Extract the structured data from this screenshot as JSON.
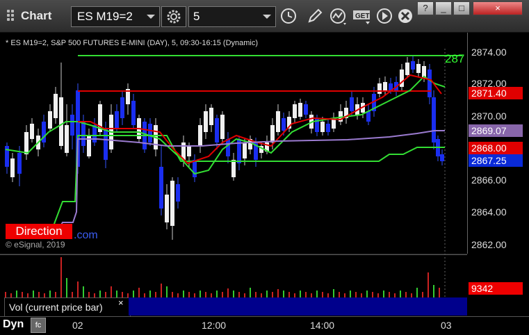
{
  "window": {
    "title": "Chart",
    "symbol": "ES M19=2",
    "interval": "5",
    "buttons": {
      "help": "?",
      "minimize": "_",
      "maximize": "□",
      "close": "×"
    }
  },
  "chart": {
    "header": "* ES M19=2, S&P 500 FUTURES E-MINI (DAY), 5, 09:30-16:15 (Dynamic)",
    "price_labels": [
      "2874.00",
      "2872.00",
      "2870.00",
      "2866.00",
      "2864.00",
      "2862.00"
    ],
    "price_tags": [
      {
        "text": "2871.40",
        "color": "#e00000"
      },
      {
        "text": "2869.07",
        "color": "#8866aa"
      },
      {
        "text": "2868.00",
        "color": "#e00000"
      },
      {
        "text": "2867.25",
        "color": "#0a2ad8"
      }
    ],
    "cutoff_label": "287",
    "direction_label": "Direction",
    "watermark_suffix": ".com",
    "copyright": "© eSignal, 2019"
  },
  "chart_data": {
    "type": "candlestick",
    "ylim": [
      2861.5,
      2875
    ],
    "y_ticks": [
      2874,
      2872,
      2870,
      2866,
      2864,
      2862
    ],
    "x_ticks": [
      "02",
      "12:00",
      "14:00",
      "03"
    ],
    "lines": [
      {
        "name": "",
        "color": "#33dd33",
        "value": 2873.6
      },
      {
        "name": "",
        "color": "#e00000",
        "value": 2871.4
      }
    ]
  },
  "volume": {
    "label": "Vol (current price bar)",
    "close_x": "×",
    "value": "9342"
  },
  "time_axis": {
    "dyn": "Dyn",
    "fc": "fc",
    "labels": [
      "02",
      "12:00",
      "14:00",
      "03"
    ]
  }
}
